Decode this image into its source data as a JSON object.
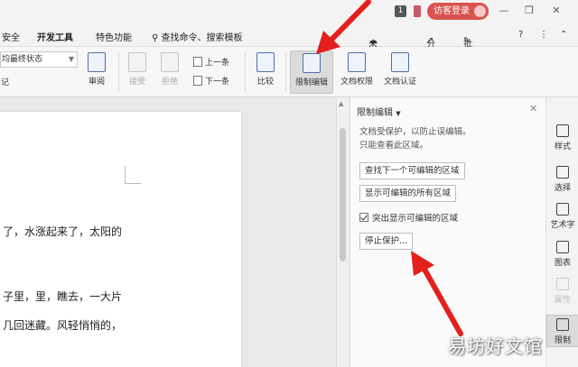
{
  "titlebar": {
    "count_badge": "1",
    "login_label": "访客登录",
    "controls": [
      "—",
      "❐",
      "✕"
    ]
  },
  "menubar": {
    "tabs": [
      "安全",
      "开发工具",
      "特色功能"
    ],
    "search_label": "查找命令、搜索模板",
    "right": {
      "sync": "未同步",
      "share": "分享",
      "comment": "批注",
      "help": "?",
      "more": "⋮",
      "collapse": "⌃"
    }
  },
  "ribbon": {
    "combo_value": "均最终状态",
    "small_label": "记",
    "review": "审阅",
    "accept": "接受",
    "reject": "拒绝",
    "prev": "上一条",
    "next": "下一条",
    "compare": "比较",
    "restrict_edit": "限制编辑",
    "doc_permission": "文档权限",
    "doc_certify": "文档认证"
  },
  "document": {
    "lines": [
      "了，水涨起来了，太阳的",
      "子里，里，瞧去，一大片",
      "几回迷藏。风轻悄悄的，"
    ]
  },
  "panel": {
    "title": "限制编辑",
    "close": "✕",
    "desc_line1": "文档受保护，以防止误编辑。",
    "desc_line2": "只能查看此区域。",
    "find_next": "查找下一个可编辑的区域",
    "show_all": "显示可编辑的所有区域",
    "highlight_label": "突出显示可编辑的区域",
    "highlight_checked": true,
    "stop_protect": "停止保护..."
  },
  "sidebar": {
    "items": [
      "样式",
      "选择",
      "艺术字",
      "图表",
      "属性",
      "限制"
    ]
  },
  "watermark": "易坊好文馆",
  "colors": {
    "accent_red": "#e3201c",
    "login_red": "#d9534f"
  }
}
